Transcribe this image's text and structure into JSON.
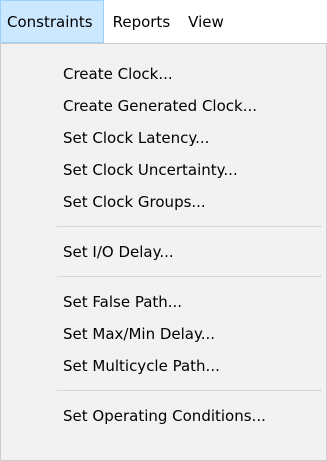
{
  "menubar": {
    "items": [
      {
        "label": "Constraints"
      },
      {
        "label": "Reports"
      },
      {
        "label": "View"
      }
    ]
  },
  "menu": {
    "items": [
      {
        "label": "Create Clock..."
      },
      {
        "label": "Create Generated Clock..."
      },
      {
        "label": "Set Clock Latency..."
      },
      {
        "label": "Set Clock Uncertainty..."
      },
      {
        "label": "Set Clock Groups..."
      },
      {
        "label": "Set I/O Delay..."
      },
      {
        "label": "Set False Path..."
      },
      {
        "label": "Set Max/Min Delay..."
      },
      {
        "label": "Set Multicycle Path..."
      },
      {
        "label": "Set Operating Conditions..."
      }
    ]
  }
}
